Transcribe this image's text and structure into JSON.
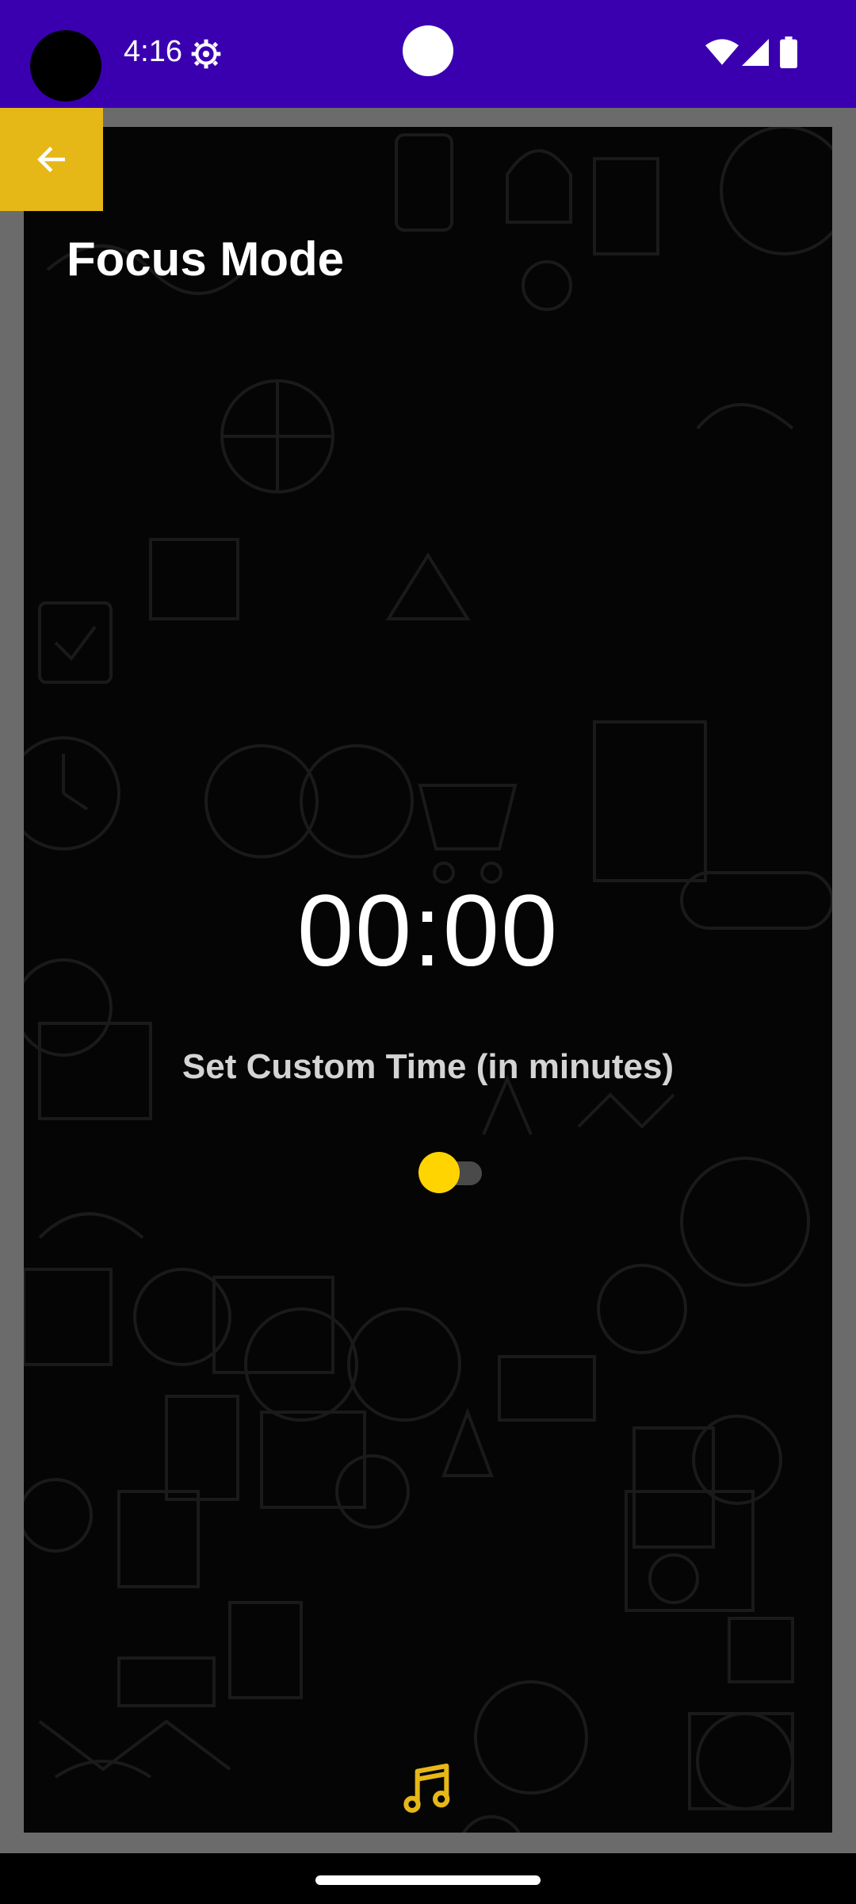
{
  "status_bar": {
    "time": "4:16",
    "icons": [
      "gear-icon",
      "wifi-icon",
      "signal-icon",
      "battery-icon"
    ],
    "background": "#3A00B0"
  },
  "header": {
    "title": "Focus Mode",
    "back_icon": "arrow-left-icon",
    "back_button_color": "#E6B817"
  },
  "timer": {
    "display": "00:00",
    "custom_time_label": "Set Custom Time (in minutes)",
    "custom_time_enabled": false
  },
  "footer": {
    "music_icon": "music-note-icon",
    "accent": "#E6B817"
  }
}
